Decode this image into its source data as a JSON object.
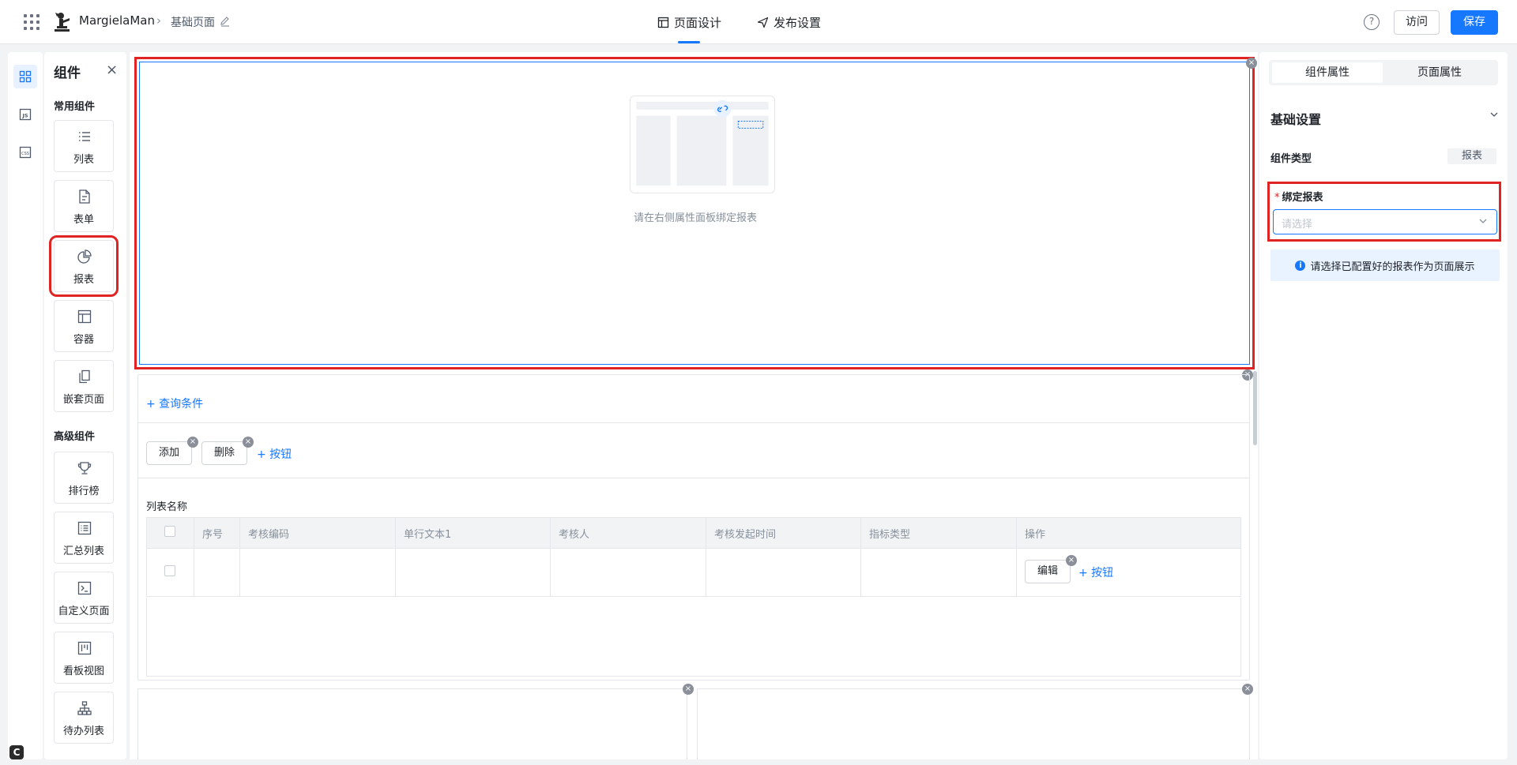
{
  "header": {
    "app_name": "MargielaMan",
    "page_name": "基础页面",
    "tabs": [
      {
        "label": "页面设计"
      },
      {
        "label": "发布设置"
      }
    ],
    "visit_label": "访问",
    "save_label": "保存"
  },
  "rail": {
    "items": [
      "components-icon",
      "js-icon",
      "css-icon"
    ],
    "badge": "C"
  },
  "components": {
    "title": "组件",
    "common_title": "常用组件",
    "common": [
      {
        "label": "列表",
        "icon": "list-icon"
      },
      {
        "label": "表单",
        "icon": "form-icon"
      },
      {
        "label": "报表",
        "icon": "chart-pie-icon"
      },
      {
        "label": "容器",
        "icon": "container-icon"
      },
      {
        "label": "嵌套页面",
        "icon": "nested-page-icon"
      }
    ],
    "advanced_title": "高级组件",
    "advanced": [
      {
        "label": "排行榜",
        "icon": "trophy-icon"
      },
      {
        "label": "汇总列表",
        "icon": "summary-list-icon"
      },
      {
        "label": "自定义页面",
        "icon": "terminal-icon"
      },
      {
        "label": "看板视图",
        "icon": "kanban-icon"
      },
      {
        "label": "待办列表",
        "icon": "org-tree-icon"
      }
    ]
  },
  "canvas": {
    "report_placeholder": "请在右侧属性面板绑定报表",
    "query_condition": "+ 查询条件",
    "buttons": [
      {
        "label": "添加"
      },
      {
        "label": "删除"
      }
    ],
    "add_button": "+ 按钮",
    "list_title": "列表名称",
    "columns": [
      "序号",
      "考核编码",
      "单行文本1",
      "考核人",
      "考核发起时间",
      "指标类型",
      "操作"
    ],
    "row_edit": "编辑",
    "row_add_button": "+ 按钮"
  },
  "props": {
    "tabs": [
      {
        "label": "组件属性"
      },
      {
        "label": "页面属性"
      }
    ],
    "section": "基础设置",
    "type_label": "组件类型",
    "type_value": "报表",
    "bind_label": "绑定报表",
    "required_mark": "*",
    "select_placeholder": "请选择",
    "tip": "请选择已配置好的报表作为页面展示"
  }
}
